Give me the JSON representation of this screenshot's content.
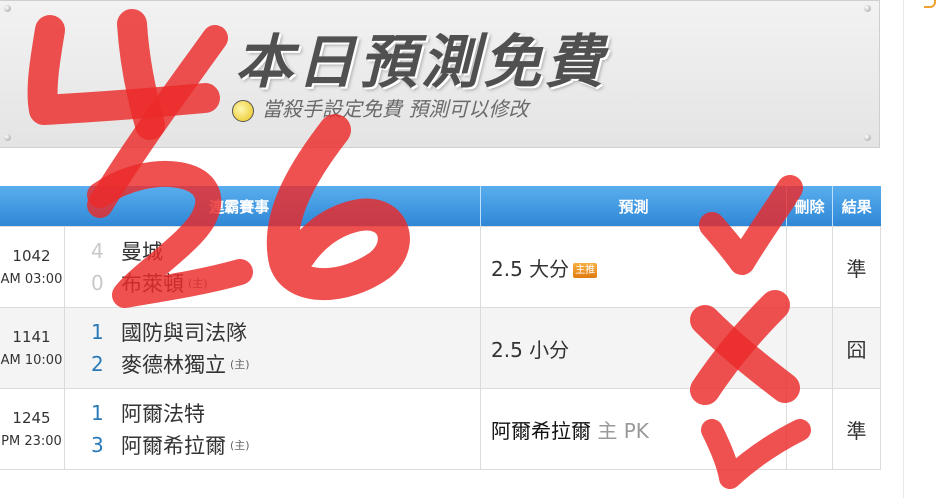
{
  "banner": {
    "title": "本日預測免費",
    "subtitle": "當殺手設定免費  預測可以修改"
  },
  "table": {
    "headers": {
      "match": "連霸賽事",
      "prediction": "預測",
      "delete": "刪除",
      "result": "結果"
    },
    "rows": [
      {
        "id": "1042",
        "time": "AM 03:00",
        "home_score": "4",
        "away_score": "0",
        "team1": "曼城",
        "team2": "布萊頓",
        "team1_mark": "",
        "team2_mark": "(主)",
        "prediction": "2.5 大分",
        "prediction_note": "",
        "tag": "主推",
        "result": "準"
      },
      {
        "id": "1141",
        "time": "AM 10:00",
        "home_score": "1",
        "away_score": "2",
        "team1": "國防與司法隊",
        "team2": "麥德林獨立",
        "team1_mark": "",
        "team2_mark": "(主)",
        "prediction": "2.5 小分",
        "prediction_note": "",
        "tag": "",
        "result": "囧"
      },
      {
        "id": "1245",
        "time": "PM 23:00",
        "home_score": "1",
        "away_score": "3",
        "team1": "阿爾法特",
        "team2": "阿爾希拉爾",
        "team1_mark": "",
        "team2_mark": "(主)",
        "prediction": "阿爾希拉爾",
        "prediction_note": "主 PK",
        "tag": "",
        "result": "準"
      }
    ]
  },
  "annotation": {
    "handwritten_date": "4/26"
  },
  "colors": {
    "header_blue": "#3a93de",
    "hit_green": "#2f9a3a",
    "ink_red": "#ec2a2a",
    "score_blue": "#2a7ab8"
  }
}
